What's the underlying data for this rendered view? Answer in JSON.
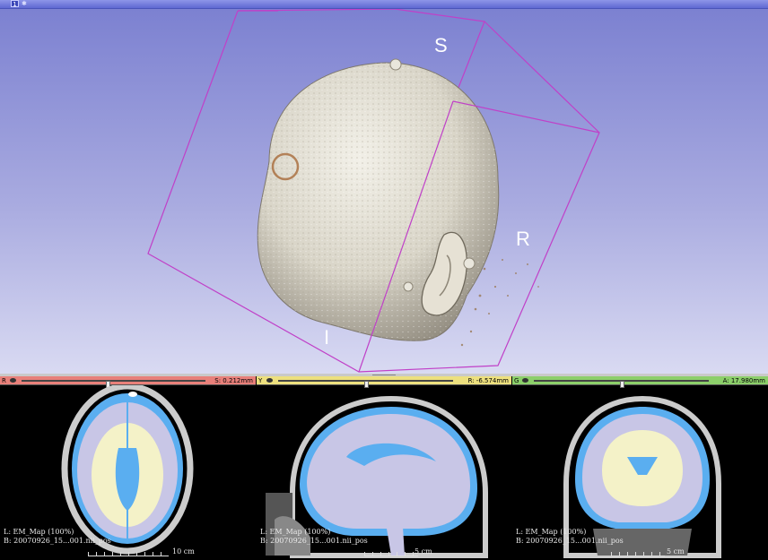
{
  "view3d": {
    "view_number": "1",
    "orientation_labels": {
      "superior": "S",
      "right": "R",
      "inferior": "I"
    }
  },
  "slices": [
    {
      "id": "red",
      "letter": "R",
      "offset": "S: 0.212mm",
      "color": "#e8807a",
      "slider_position": 0.47,
      "label_line1": "L: EM_Map (100%)",
      "label_line2": "B: 20070926_15...001.nii_pos",
      "scale": "10 cm"
    },
    {
      "id": "yellow",
      "letter": "Y",
      "offset": "R: -6.574mm",
      "color": "#ede07e",
      "slider_position": 0.5,
      "label_line1": "L: EM_Map (100%)",
      "label_line2": "B: 20070926_15...001.nii_pos",
      "scale": "5 cm"
    },
    {
      "id": "green",
      "letter": "G",
      "offset": "A: 17.980mm",
      "color": "#8ccf6a",
      "slider_position": 0.5,
      "label_line1": "L: EM_Map (100%)",
      "label_line2": "B: 20070926_15...001.nii_pos",
      "scale": "5 cm"
    }
  ],
  "colors": {
    "background_top": "#7a7fd0",
    "background_bottom": "#d9daf2",
    "bounding_box": "#c040c8",
    "white_matter": "#f4f2c8",
    "gray_matter": "#c8c6e6",
    "csf": "#5aaef0"
  }
}
